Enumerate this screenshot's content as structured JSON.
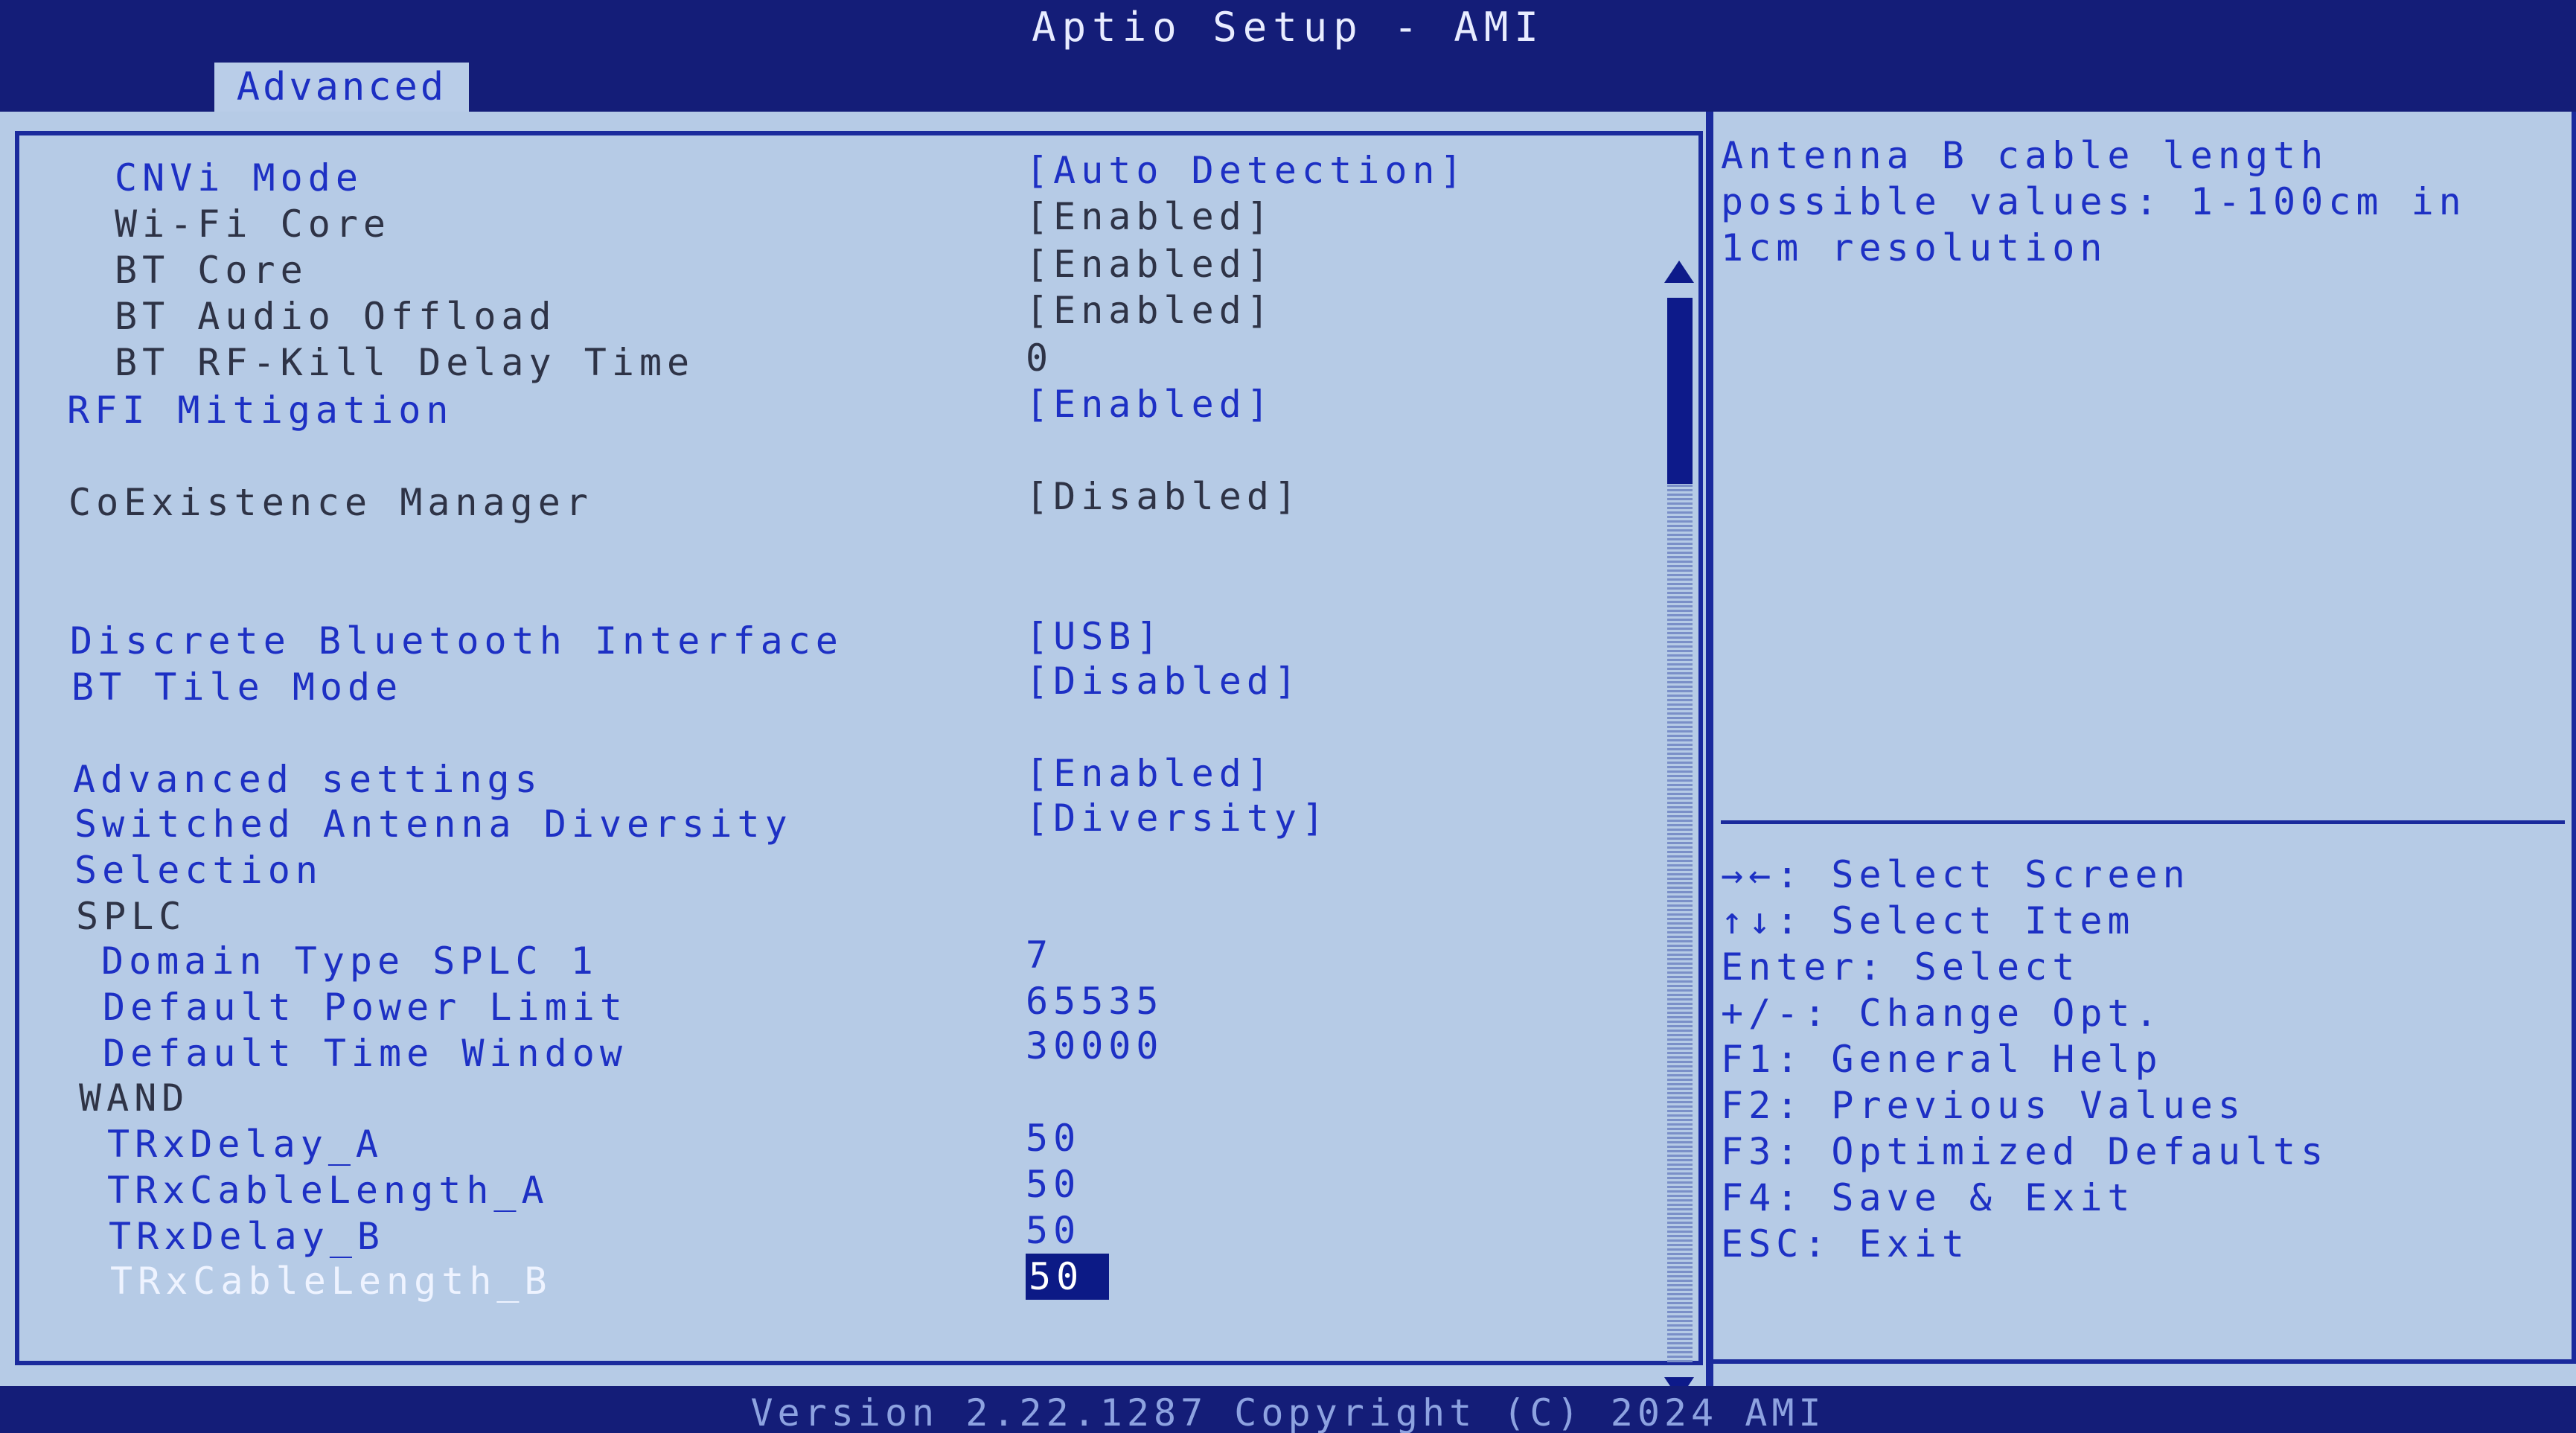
{
  "app": {
    "title": "Aptio Setup - AMI"
  },
  "tabs": [
    {
      "label": "Advanced",
      "active": true
    }
  ],
  "settings": [
    {
      "label": "CNVi Mode",
      "value": "[Auto Detection]",
      "style": "blue"
    },
    {
      "label": "Wi-Fi Core",
      "value": "[Enabled]",
      "style": "grey"
    },
    {
      "label": "BT Core",
      "value": "[Enabled]",
      "style": "grey"
    },
    {
      "label": "BT Audio Offload",
      "value": "[Enabled]",
      "style": "grey"
    },
    {
      "label": "BT RF-Kill Delay Time",
      "value": "0",
      "style": "grey"
    },
    {
      "label": "RFI Mitigation",
      "value": "[Enabled]",
      "style": "blue"
    },
    {
      "label": "CoExistence Manager",
      "value": "[Disabled]",
      "style": "grey"
    },
    {
      "label": "Discrete Bluetooth Interface",
      "value": "[USB]",
      "style": "blue"
    },
    {
      "label": "BT Tile Mode",
      "value": "[Disabled]",
      "style": "blue"
    },
    {
      "label": "Advanced settings",
      "value": "[Enabled]",
      "style": "blue"
    },
    {
      "label": "Switched Antenna Diversity",
      "label_line2": "Selection",
      "value": "[Diversity]",
      "style": "blue"
    },
    {
      "label": "SPLC",
      "value": "",
      "style": "grey"
    },
    {
      "label": "Domain Type SPLC 1",
      "value": "7",
      "style": "blue"
    },
    {
      "label": "Default Power Limit",
      "value": "65535",
      "style": "blue"
    },
    {
      "label": "Default Time Window",
      "value": "30000",
      "style": "blue"
    },
    {
      "label": "WAND",
      "value": "",
      "style": "grey"
    },
    {
      "label": "TRxDelay_A",
      "value": "50",
      "style": "blue"
    },
    {
      "label": "TRxCableLength_A",
      "value": "50",
      "style": "blue"
    },
    {
      "label": "TRxDelay_B",
      "value": "50",
      "style": "blue"
    },
    {
      "label": "TRxCableLength_B",
      "value": "50",
      "style": "selected"
    }
  ],
  "help": {
    "lines": [
      "Antenna B cable length",
      "possible values: 1-100cm in",
      "1cm resolution"
    ]
  },
  "keys": [
    "→←: Select Screen",
    "↑↓: Select Item",
    "Enter: Select",
    "+/-: Change Opt.",
    "F1: General Help",
    "F2: Previous Values",
    "F3: Optimized Defaults",
    "F4: Save & Exit",
    "ESC: Exit"
  ],
  "footer": {
    "copyright": "Version 2.22.1287 Copyright (C) 2024 AMI"
  },
  "colors": {
    "background": "#b6cbe6",
    "title_bar": "#141d78",
    "active_text": "#1d30c4",
    "inactive_text": "#2e3346",
    "selection": "#0c1a86"
  },
  "icons": {
    "scroll_up": "scroll-up-arrow-icon",
    "scroll_down": "scroll-down-arrow-icon"
  }
}
